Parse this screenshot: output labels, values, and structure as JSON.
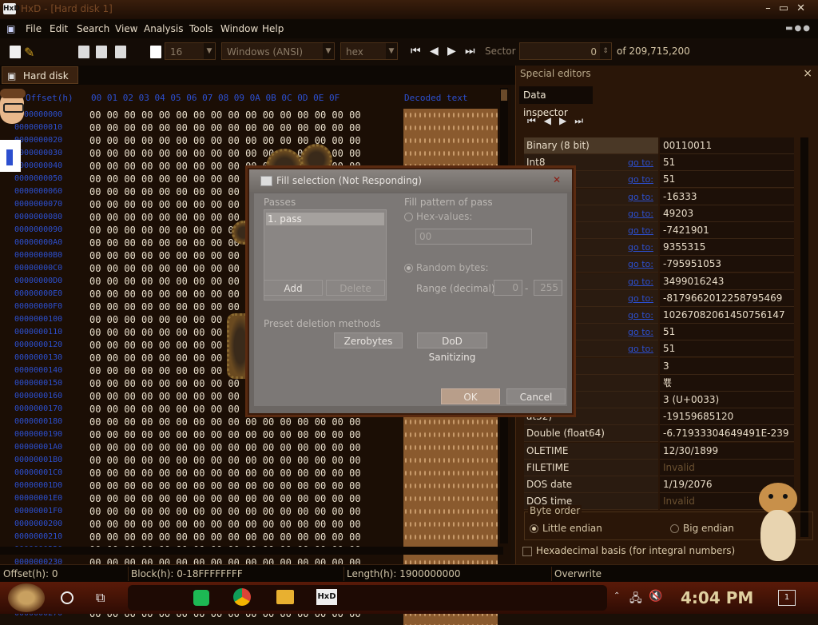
{
  "window": {
    "title": "HxD - [Hard disk 1]",
    "app_icon": "HxD"
  },
  "menu": [
    "File",
    "Edit",
    "Search",
    "View",
    "Analysis",
    "Tools",
    "Window",
    "Help"
  ],
  "toolbar": {
    "bytes_per_row": "16",
    "charset": "Windows (ANSI)",
    "display": "hex",
    "sector_label": "Sector",
    "sector_value": "0",
    "sector_total": "of 209,715,200"
  },
  "tab": {
    "label": "Hard disk 1"
  },
  "hex": {
    "header_offset": "Offset(h)",
    "header_columns": "00 01 02 03 04 05 06 07 08 09 0A 0B 0C 0D 0E 0F",
    "header_text": "Decoded text",
    "offsets": [
      "0000000000",
      "0000000010",
      "0000000020",
      "0000000030",
      "0000000040",
      "0000000050",
      "0000000060",
      "0000000070",
      "0000000080",
      "0000000090",
      "00000000A0",
      "00000000B0",
      "00000000C0",
      "00000000D0",
      "00000000E0",
      "00000000F0",
      "0000000100",
      "0000000110",
      "0000000120",
      "0000000130",
      "0000000140",
      "0000000150",
      "0000000160",
      "0000000170",
      "0000000180",
      "0000000190",
      "00000001A0",
      "00000001B0",
      "00000001C0",
      "00000001D0",
      "00000001E0",
      "00000001F0",
      "0000000200",
      "0000000210",
      "0000000220",
      "0000000230",
      "0000000240",
      "0000000250",
      "0000000260",
      "0000000270"
    ],
    "row_bytes": "00 00 00 00 00 00 00 00 00 00 00 00 00 00 00 00"
  },
  "special": {
    "title": "Special editors",
    "tab": "Data inspector",
    "rows": [
      {
        "name": "Binary (8 bit)",
        "link": "",
        "value": "00110011"
      },
      {
        "name": "Int8",
        "link": "go to:",
        "value": "51"
      },
      {
        "name": "",
        "link": "go to:",
        "value": "51"
      },
      {
        "name": "",
        "link": "go to:",
        "value": "-16333"
      },
      {
        "name": "",
        "link": "go to:",
        "value": "49203"
      },
      {
        "name": "",
        "link": "go to:",
        "value": "-7421901"
      },
      {
        "name": "",
        "link": "go to:",
        "value": "9355315"
      },
      {
        "name": "",
        "link": "go to:",
        "value": "-795951053"
      },
      {
        "name": "",
        "link": "go to:",
        "value": "3499016243"
      },
      {
        "name": "",
        "link": "go to:",
        "value": "-8179662012258795469"
      },
      {
        "name": "",
        "link": "go to:",
        "value": "10267082061450756147"
      },
      {
        "name": "",
        "link": "go to:",
        "value": "51"
      },
      {
        "name": "",
        "link": "go to:",
        "value": "51"
      },
      {
        "name": "har8_t",
        "link": "",
        "value": "3"
      },
      {
        "name": "char16_t",
        "link": "",
        "value": "뾳"
      },
      {
        "name": "e point",
        "link": "",
        "value": "3 (U+0033)"
      },
      {
        "name": "at32)",
        "link": "",
        "value": "-19159685120"
      },
      {
        "name": "Double (float64)",
        "link": "",
        "value": "-6.71933304649491E-239"
      },
      {
        "name": "OLETIME",
        "link": "",
        "value": "12/30/1899"
      },
      {
        "name": "FILETIME",
        "link": "",
        "value": "Invalid"
      },
      {
        "name": "DOS date",
        "link": "",
        "value": "1/19/2076"
      },
      {
        "name": "DOS time",
        "link": "",
        "value": "Invalid"
      }
    ],
    "byte_order_label": "Byte order",
    "little_endian": "Little endian",
    "big_endian": "Big endian",
    "hex_basis": "Hexadecimal basis (for integral numbers)"
  },
  "status": {
    "offset": "Offset(h): 0",
    "block": "Block(h): 0-18FFFFFFFF",
    "length": "Length(h): 1900000000",
    "mode": "Overwrite"
  },
  "dialog": {
    "title": "Fill selection (Not Responding)",
    "passes_label": "Passes",
    "pass_item": "1. pass",
    "add": "Add",
    "delete": "Delete",
    "fill_pattern_label": "Fill pattern of pass",
    "hex_values": "Hex-values:",
    "hex_value_field": "00",
    "random_bytes": "Random bytes:",
    "range_label": "Range (decimal):",
    "range_from": "0",
    "range_dash": "-",
    "range_to": "255",
    "preset_label": "Preset deletion methods",
    "zerobytes": "Zerobytes",
    "dod": "DoD Sanitizing",
    "ok": "OK",
    "cancel": "Cancel"
  },
  "taskbar": {
    "clock": "4:04 PM",
    "apps": [
      "spotify-icon",
      "chrome-icon",
      "folder-icon",
      "hxd-icon"
    ],
    "notification_count": "1"
  }
}
